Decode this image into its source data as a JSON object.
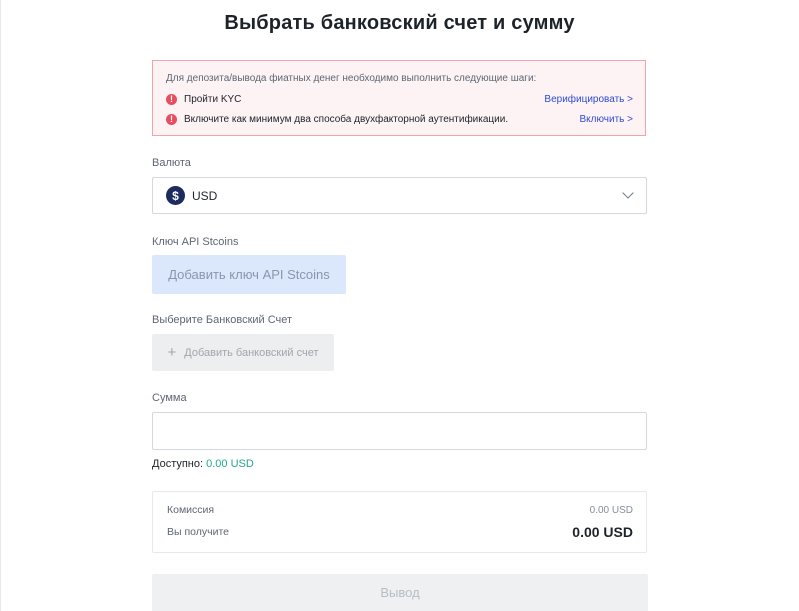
{
  "page": {
    "title": "Выбрать банковский счет и сумму"
  },
  "alert": {
    "intro": "Для депозита/вывода фиатных денег необходимо выполнить следующие шаги:",
    "steps": [
      {
        "text": "Пройти KYC",
        "link": "Верифицировать >"
      },
      {
        "text": "Включите как минимум два способа двухфакторной аутентификации.",
        "link": "Включить >"
      }
    ],
    "icon": "exclamation-circle-icon",
    "color": "#e84e5f"
  },
  "currency": {
    "label": "Валюта",
    "selected": "USD",
    "icon": "dollar-coin-icon"
  },
  "api_key": {
    "label": "Ключ API Stcoins",
    "button": "Добавить ключ API Stcoins"
  },
  "bank_account": {
    "label": "Выберите Банковский Счет",
    "button": "Добавить банковский счет",
    "icon": "plus-icon"
  },
  "amount": {
    "label": "Сумма",
    "value": "",
    "available_label": "Доступно:",
    "available_value": "0.00 USD"
  },
  "summary": {
    "fee_label": "Комиссия",
    "fee_value": "0.00 USD",
    "receive_label": "Вы получите",
    "receive_value": "0.00 USD"
  },
  "withdraw": {
    "button": "Вывод"
  },
  "colors": {
    "accent_link": "#2e4cd3",
    "available": "#23a68b",
    "alert_bg": "#fdf3f4",
    "alert_border": "#f3a3ad"
  }
}
